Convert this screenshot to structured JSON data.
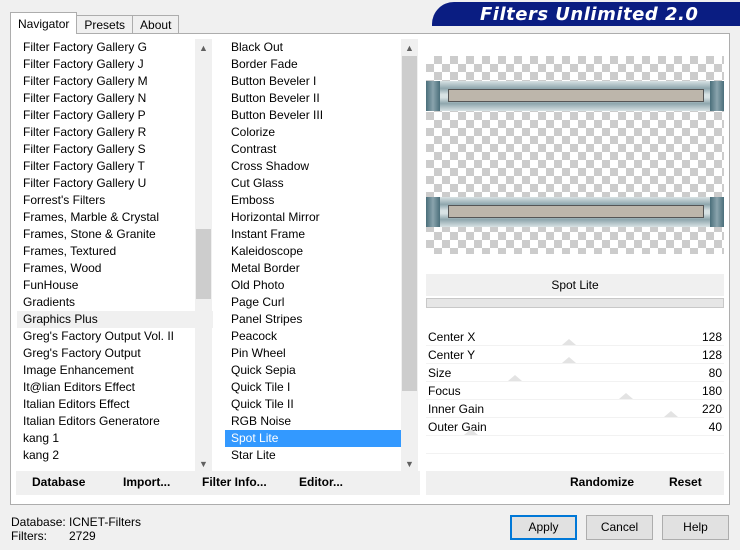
{
  "tabs": [
    "Navigator",
    "Presets",
    "About"
  ],
  "banner_title": "Filters Unlimited 2.0",
  "categories": [
    "Filter Factory Gallery G",
    "Filter Factory Gallery J",
    "Filter Factory Gallery M",
    "Filter Factory Gallery N",
    "Filter Factory Gallery P",
    "Filter Factory Gallery R",
    "Filter Factory Gallery S",
    "Filter Factory Gallery T",
    "Filter Factory Gallery U",
    "Forrest's Filters",
    "Frames, Marble & Crystal",
    "Frames, Stone & Granite",
    "Frames, Textured",
    "Frames, Wood",
    "FunHouse",
    "Gradients",
    "Graphics Plus",
    "Greg's Factory Output Vol. II",
    "Greg's Factory Output",
    "Image Enhancement",
    "It@lian Editors Effect",
    "Italian Editors Effect",
    "Italian Editors Generatore",
    "kang 1",
    "kang 2"
  ],
  "selected_category": "Graphics Plus",
  "filters": [
    "Black Out",
    "Border Fade",
    "Button Beveler I",
    "Button Beveler II",
    "Button Beveler III",
    "Colorize",
    "Contrast",
    "Cross Shadow",
    "Cut Glass",
    "Emboss",
    "Horizontal Mirror",
    "Instant Frame",
    "Kaleidoscope",
    "Metal Border",
    "Old Photo",
    "Page Curl",
    "Panel Stripes",
    "Peacock",
    "Pin Wheel",
    "Quick Sepia",
    "Quick Tile I",
    "Quick Tile II",
    "RGB Noise",
    "Spot Lite",
    "Star Lite"
  ],
  "selected_filter": "Spot Lite",
  "preview_filter_name": "Spot Lite",
  "parameters": [
    {
      "name": "Center X",
      "value": 128
    },
    {
      "name": "Center Y",
      "value": 128
    },
    {
      "name": "Size",
      "value": 80
    },
    {
      "name": "Focus",
      "value": 180
    },
    {
      "name": "Inner Gain",
      "value": 220
    },
    {
      "name": "Outer Gain",
      "value": 40
    }
  ],
  "toolbar": {
    "database": "Database",
    "import": "Import...",
    "filter_info": "Filter Info...",
    "editor": "Editor...",
    "randomize": "Randomize",
    "reset": "Reset"
  },
  "status": {
    "database_label": "Database:",
    "database_value": "ICNET-Filters",
    "filters_label": "Filters:",
    "filters_value": "2729"
  },
  "buttons": {
    "apply": "Apply",
    "cancel": "Cancel",
    "help": "Help"
  }
}
